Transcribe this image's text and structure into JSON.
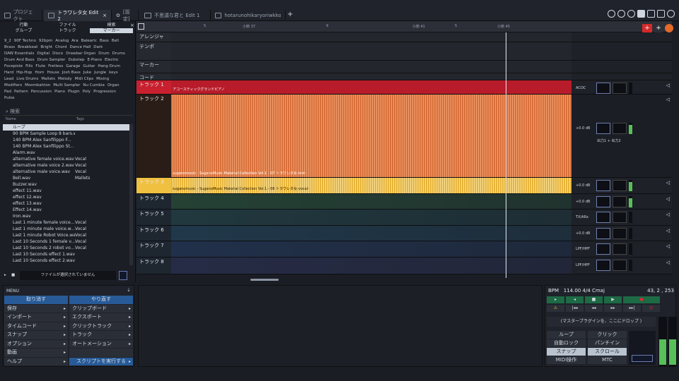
{
  "tabs": [
    {
      "label": "プロジェクト",
      "active": false,
      "icon": "project-icon"
    },
    {
      "label": "トラワレタ女 Edit 2",
      "active": true,
      "icon": "edit-icon"
    },
    {
      "label": "[設定]",
      "active": false,
      "icon": "gear-icon"
    },
    {
      "label": "不思議な君と Edit 1",
      "active": false,
      "icon": "edit-icon"
    },
    {
      "label": "hotarunohikaryoriwkko...",
      "active": false,
      "icon": "edit-icon"
    }
  ],
  "browser": {
    "tabs_row1": [
      "行動",
      "ファイル",
      "検索"
    ],
    "tabs_row2": [
      "グループ",
      "トラック",
      "マーカー"
    ],
    "tags": [
      "9_2",
      "90F Techno",
      "92bpm",
      "Analog",
      "Ara",
      "Balearic",
      "Bass",
      "Bell",
      "Brass",
      "Breakbeat",
      "Bright",
      "Chord",
      "Dance Hall",
      "Dark",
      "DAW Essentials",
      "Digital",
      "Disco",
      "Drawbar Organ",
      "Drum",
      "Drums",
      "Drum And Bass",
      "Drum Sampler",
      "Dubstep",
      "E-Piano",
      "Electro",
      "Focepiste",
      "Fills",
      "Flute",
      "Fretless",
      "Garage",
      "Guitar",
      "Hang Drum",
      "Hard",
      "Hip-Hop",
      "Horn",
      "House",
      "Josh Bass",
      "Juke",
      "Jungle",
      "keys",
      "Lead",
      "Live Drums",
      "Mallets",
      "Melody",
      "Midi Clips",
      "Mixing",
      "Modifiers",
      "Moombahton",
      "Multi Sampler",
      "Nu Cumbia",
      "Organ",
      "Pad",
      "Pattern",
      "Percussion",
      "Piano",
      "Plugin",
      "Poly",
      "Progression",
      "Pulse"
    ],
    "search_placeholder": "検索",
    "col_name": "Name",
    "col_tags": "Tags",
    "files": [
      {
        "name": "ループ",
        "tag": ""
      },
      {
        "name": "90 BPM Sample Loop 8 bars.wav",
        "tag": ""
      },
      {
        "name": "140 BPM Alex Sanfilippo F...",
        "tag": ""
      },
      {
        "name": "140 BPM Alex Sanfilippo St...",
        "tag": ""
      },
      {
        "name": "Alarm.wav",
        "tag": ""
      },
      {
        "name": "alternative female voice.wav",
        "tag": "Vocal"
      },
      {
        "name": "alternative male voice 2.wav",
        "tag": "Vocal"
      },
      {
        "name": "alternative male voice.wav",
        "tag": "Vocal"
      },
      {
        "name": "Bell.wav",
        "tag": "Mallets"
      },
      {
        "name": "Buzzer.wav",
        "tag": ""
      },
      {
        "name": "effect 11.wav",
        "tag": ""
      },
      {
        "name": "effect 12.wav",
        "tag": ""
      },
      {
        "name": "effect 13.wav",
        "tag": ""
      },
      {
        "name": "Effect 14.wav",
        "tag": ""
      },
      {
        "name": "Iron.wav",
        "tag": ""
      },
      {
        "name": "Last 1 minute female voice...",
        "tag": "Vocal"
      },
      {
        "name": "Last 1 minute male voice.w...",
        "tag": "Vocal"
      },
      {
        "name": "Last 1 minute Robot Voice.wav",
        "tag": "Vocal"
      },
      {
        "name": "Last 10 Seconds 1 female v...",
        "tag": "Vocal"
      },
      {
        "name": "Last 10 Seconds 2 robot vo...",
        "tag": "Vocal"
      },
      {
        "name": "Last 10 Seconds effect 1.wav",
        "tag": ""
      },
      {
        "name": "Last 10 Seconds effect 2.wav",
        "tag": ""
      }
    ],
    "status": "ファイルが選択されていません"
  },
  "ruler": {
    "bars": [
      "5",
      "小節 37",
      "9",
      "",
      "小節 41",
      "5",
      "小節 45"
    ]
  },
  "global_lanes": [
    "アレンジャー",
    "テンポ",
    "マーカー",
    "コード"
  ],
  "tracks": [
    {
      "name": "トラック 1",
      "clip": "アコースティックグランドピアノ",
      "color": "#c8202e",
      "plugin": "ACOC"
    },
    {
      "name": "トラック 2",
      "clip": "suganomusic - SuganoMusic Material Collection Vol.1 - 07 トラワレタ女-inst-",
      "color": "#e37a3a",
      "db": "+0.0 dB",
      "route": "出力1 + 出力2"
    },
    {
      "name": "トラック 3",
      "clip": "suganomusic - SuganoMusic Material Collection Vol.1 - 08 トラワレタ女-vocal-",
      "color": "#f0c040",
      "db": "+0.0 dB"
    },
    {
      "name": "トラック 4",
      "clip": "",
      "color": "#3a8a56",
      "db": "+0.0 dB"
    },
    {
      "name": "トラック 5",
      "clip": "",
      "color": "#2d6f74",
      "plugin": "TX/ARx"
    },
    {
      "name": "トラック 6",
      "clip": "",
      "color": "#2d6f96",
      "db": "+0.0 dB"
    },
    {
      "name": "トラック 7",
      "clip": "",
      "color": "#2f5796",
      "plugin": "LPF/HPF"
    },
    {
      "name": "トラック 8",
      "clip": "",
      "color": "#3f4a8a",
      "plugin": "LPF/HPF"
    }
  ],
  "menu": {
    "title": "MENU",
    "items": [
      {
        "label": "取り消す",
        "blue": true,
        "arrow": ""
      },
      {
        "label": "やり直す",
        "blue": true,
        "arrow": ""
      },
      {
        "label": "保存",
        "blue": false,
        "arrow": "▸"
      },
      {
        "label": "クリップボード",
        "blue": false,
        "arrow": "▸"
      },
      {
        "label": "インポート",
        "blue": false,
        "arrow": "▸"
      },
      {
        "label": "エクスポート",
        "blue": false,
        "arrow": "▸"
      },
      {
        "label": "タイムコード",
        "blue": false,
        "arrow": "▸"
      },
      {
        "label": "クリックトラック",
        "blue": false,
        "arrow": "▸"
      },
      {
        "label": "スナップ",
        "blue": false,
        "arrow": "▸"
      },
      {
        "label": "トラック",
        "blue": false,
        "arrow": "▸"
      },
      {
        "label": "オプション",
        "blue": false,
        "arrow": "▸"
      },
      {
        "label": "オートメーション",
        "blue": false,
        "arrow": "▸"
      },
      {
        "label": "動画",
        "blue": false,
        "arrow": "▸"
      },
      {
        "label": "",
        "blue": false,
        "arrow": ""
      },
      {
        "label": "ヘルプ",
        "blue": false,
        "arrow": "▸"
      },
      {
        "label": "スクリプトを実行する",
        "blue": true,
        "arrow": "▸"
      }
    ]
  },
  "transport": {
    "bpm_label": "BPM",
    "tempo": "114.00 4/4 Cmaj",
    "position": "43, 2 , 253",
    "drop_label": "(マスタープラグインを、ここにドロップ )",
    "buttons": [
      "ループ",
      "クリック",
      "自動ロック",
      "パンチイン",
      "スナップ",
      "スクロール",
      "MIDI操作",
      "MTC"
    ],
    "active_buttons": [
      "スナップ",
      "スクロール"
    ]
  }
}
